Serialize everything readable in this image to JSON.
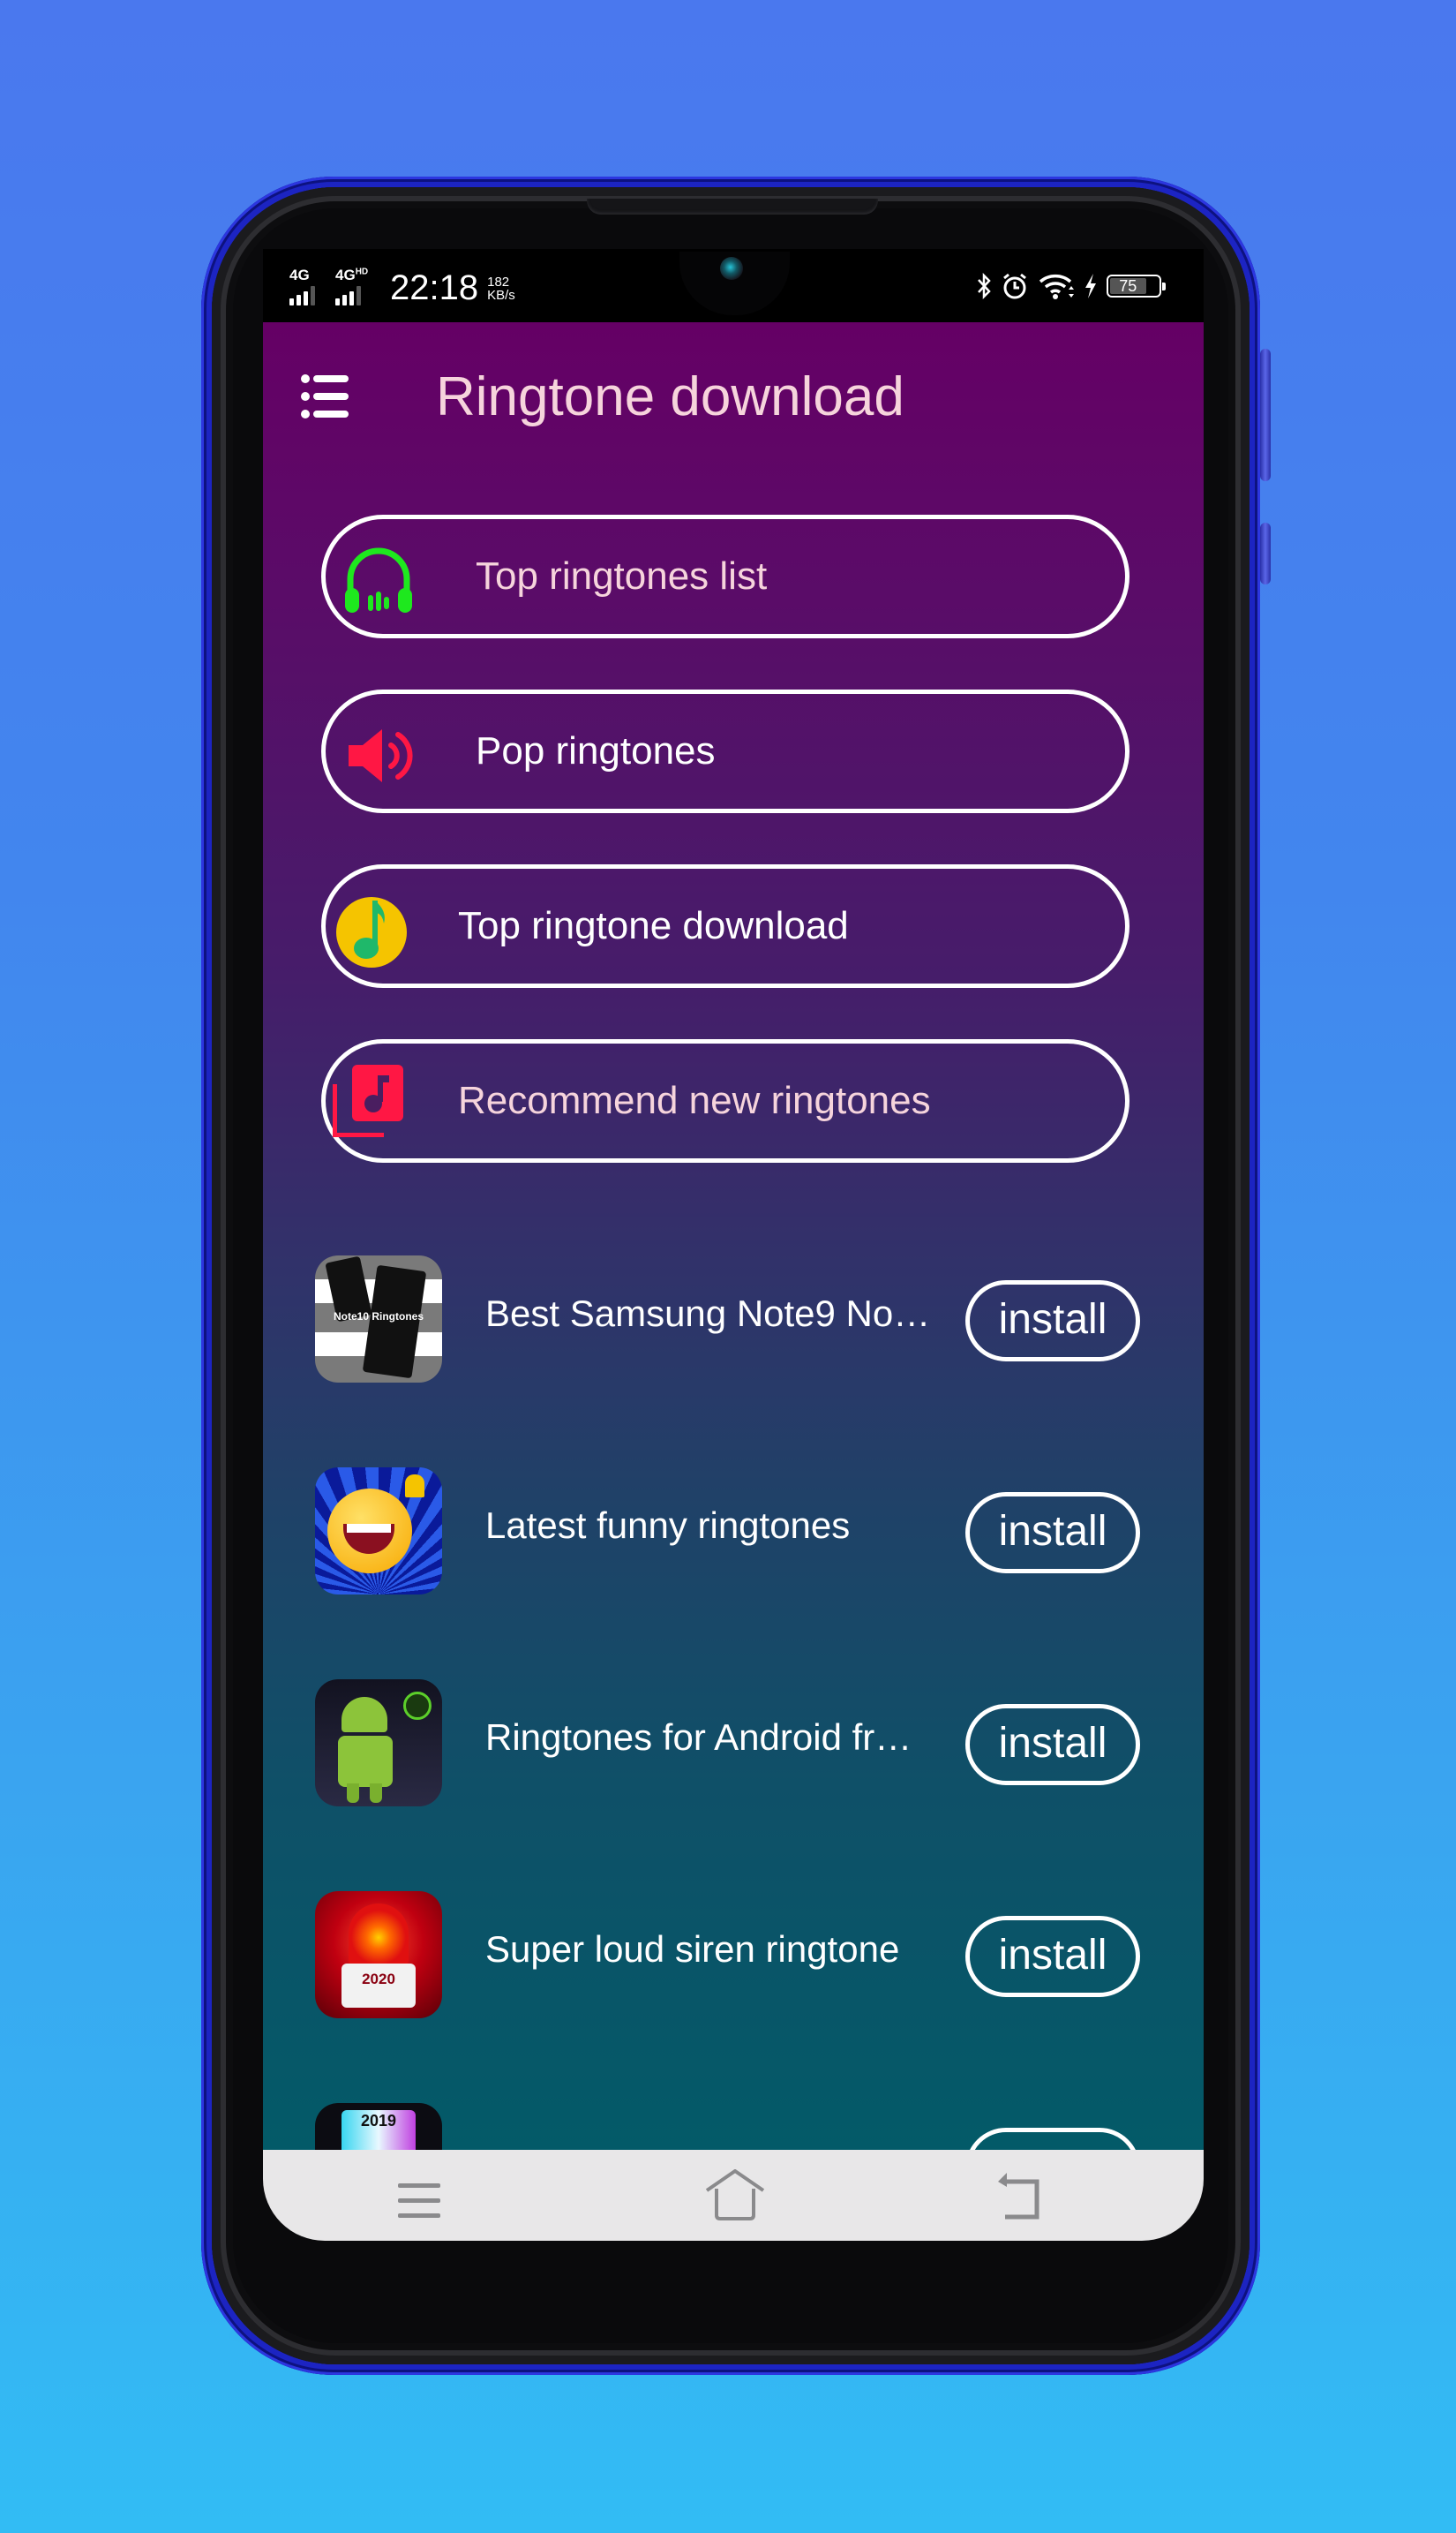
{
  "status_bar": {
    "network_1": "4G",
    "network_2": "4G",
    "network_2_sup": "HD",
    "time": "22:18",
    "speed_value": "182",
    "speed_unit": "KB/s",
    "battery_level": "75",
    "icons": [
      "bluetooth-icon",
      "alarm-icon",
      "wifi-icon",
      "charging-icon",
      "battery-icon"
    ]
  },
  "app_bar": {
    "title": "Ringtone download",
    "menu_icon": "menu-list-icon"
  },
  "categories": [
    {
      "label": "Top ringtones list",
      "icon": "headphones-icon",
      "icon_color": "#1ee81e",
      "text_color": "#f6d4dc"
    },
    {
      "label": "Pop ringtones",
      "icon": "speaker-volume-icon",
      "icon_color": "#ff1744",
      "text_color": "#ffffff"
    },
    {
      "label": "Top ringtone download",
      "icon": "music-note-icon",
      "icon_color": "#f5c400",
      "text_color": "#ffffff"
    },
    {
      "label": "Recommend new ringtones",
      "icon": "music-library-icon",
      "icon_color": "#ff1744",
      "text_color": "#f6d4dc"
    }
  ],
  "apps": [
    {
      "name": "Best Samsung Note9 No…",
      "thumb_text": "Note10 Ringtones",
      "action": "install"
    },
    {
      "name": "Latest funny ringtones",
      "thumb_text": "",
      "action": "install"
    },
    {
      "name": "Ringtones for Android fr…",
      "thumb_text": "",
      "action": "install"
    },
    {
      "name": "Super loud siren ringtone",
      "thumb_text": "2020",
      "action": "install"
    },
    {
      "name": "",
      "thumb_text": "2019",
      "action": ""
    }
  ],
  "nav_bar": {
    "keys": [
      "recents-menu-icon",
      "home-icon",
      "back-icon"
    ]
  },
  "colors": {
    "background_top": "#4a78ee",
    "background_bottom": "#32bcf4",
    "phone_rim": "#1c24c2",
    "screen_top": "#650065",
    "screen_bottom": "#035a68",
    "title_text": "#f6d4dc",
    "nav_bar": "#e8e7e8",
    "nav_icon": "#8a8a8c"
  }
}
